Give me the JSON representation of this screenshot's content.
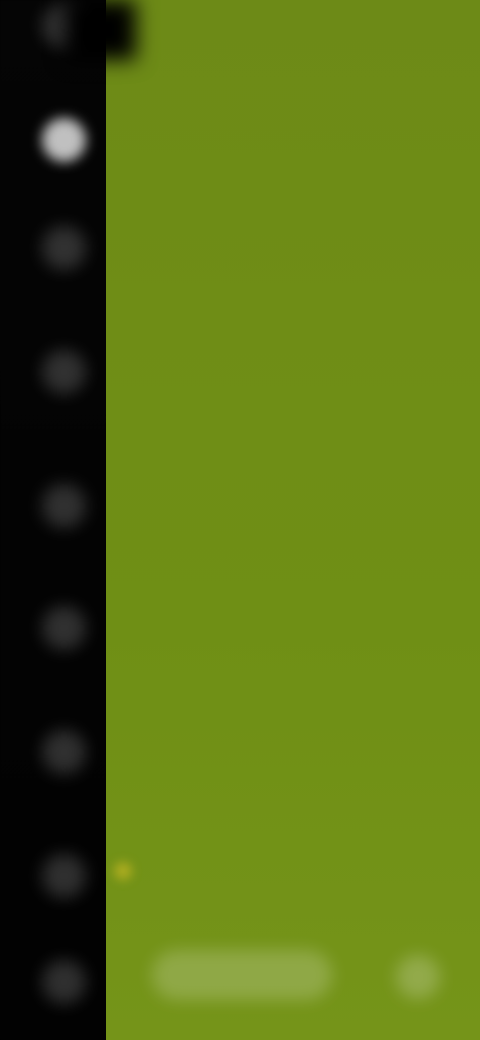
{
  "colors": {
    "rail_background": "#030303",
    "content_background": "#6f8d16",
    "accent": "#e6c828"
  },
  "rail": {
    "items": [
      {
        "icon": "menu-icon"
      },
      {
        "icon": "home-icon"
      },
      {
        "icon": "search-icon"
      },
      {
        "icon": "library-icon"
      },
      {
        "icon": "settings-icon"
      },
      {
        "icon": "profile-icon"
      },
      {
        "icon": "download-icon"
      },
      {
        "icon": "history-icon"
      },
      {
        "icon": "power-icon"
      }
    ],
    "label": ""
  },
  "content": {
    "line1_a": "",
    "line1_b": "",
    "line1_c": "",
    "line2": "",
    "line3": "",
    "bottom_button_label": ""
  }
}
